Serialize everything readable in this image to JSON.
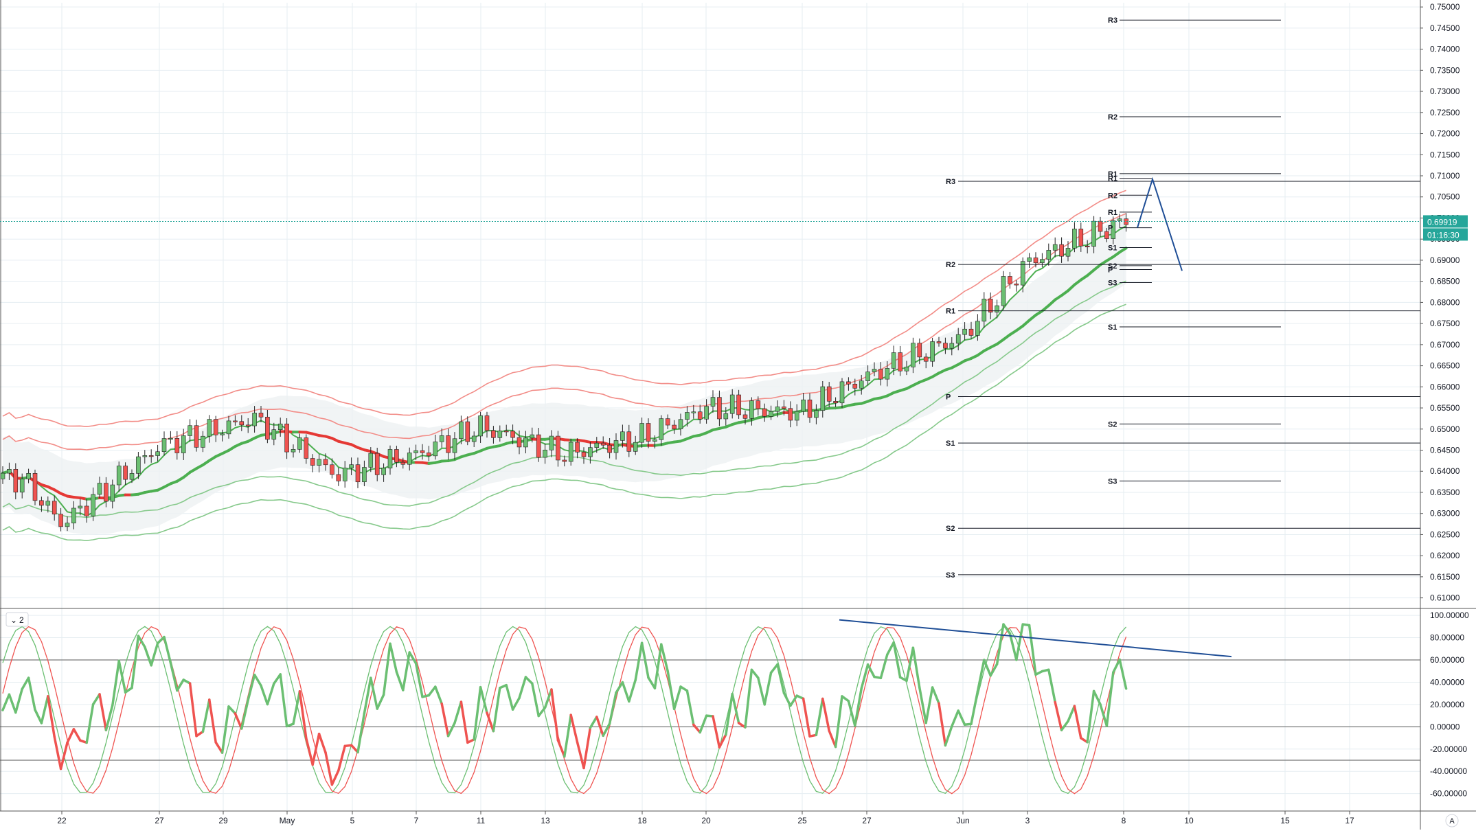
{
  "colors": {
    "bull": "#6BBF72",
    "bear": "#EF5350",
    "ma_green": "#4CAF50",
    "ma_red": "#E53935",
    "band_upper": "#F28C87",
    "band_lower": "#86C98B",
    "trend_line": "#1F4E96",
    "price_badge": "#26A69A",
    "grid": "#E6EEF2",
    "axis_text": "#131722",
    "pivot_line": "#131722"
  },
  "price_badge": "0.69919",
  "countdown_badge": "01:16:30",
  "oscillator_toggle_label": "2",
  "auto_scale_label": "A",
  "chart_data": [
    {
      "type": "candlestick",
      "title": "",
      "x_ticks": [
        "22",
        "27",
        "29",
        "May",
        "5",
        "7",
        "11",
        "13",
        "18",
        "20",
        "25",
        "27",
        "Jun",
        "3",
        "8",
        "10",
        "15",
        "17"
      ],
      "y_ticks": [
        "0.75000",
        "0.74500",
        "0.74000",
        "0.73500",
        "0.73000",
        "0.72500",
        "0.72000",
        "0.71500",
        "0.71000",
        "0.70500",
        "0.70000",
        "0.69500",
        "0.69000",
        "0.68500",
        "0.68000",
        "0.67500",
        "0.67000",
        "0.66500",
        "0.66000",
        "0.65500",
        "0.65000",
        "0.64500",
        "0.64000",
        "0.63500",
        "0.63000",
        "0.62500",
        "0.62000",
        "0.61500",
        "0.61000"
      ],
      "ylim": [
        0.6075,
        0.751
      ],
      "last_price": 0.69919,
      "ohlc_sample": [
        {
          "x": "Apr 20",
          "open": 0.637,
          "high": 0.6395,
          "low": 0.6345,
          "close": 0.6382
        },
        {
          "x": "Apr 22",
          "open": 0.633,
          "high": 0.635,
          "low": 0.6255,
          "close": 0.6275
        },
        {
          "x": "Apr 27",
          "open": 0.643,
          "high": 0.6468,
          "low": 0.642,
          "close": 0.646
        },
        {
          "x": "Apr 30",
          "open": 0.6545,
          "high": 0.657,
          "low": 0.651,
          "close": 0.6525
        },
        {
          "x": "May 4",
          "open": 0.642,
          "high": 0.644,
          "low": 0.6375,
          "close": 0.639
        },
        {
          "x": "May 7",
          "open": 0.64,
          "high": 0.6445,
          "low": 0.6385,
          "close": 0.644
        },
        {
          "x": "May 11",
          "open": 0.653,
          "high": 0.656,
          "low": 0.649,
          "close": 0.6505
        },
        {
          "x": "May 14",
          "open": 0.647,
          "high": 0.649,
          "low": 0.642,
          "close": 0.644
        },
        {
          "x": "May 18",
          "open": 0.6435,
          "high": 0.649,
          "low": 0.643,
          "close": 0.648
        },
        {
          "x": "May 20",
          "open": 0.6545,
          "high": 0.657,
          "low": 0.6525,
          "close": 0.655
        },
        {
          "x": "May 25",
          "open": 0.6535,
          "high": 0.655,
          "low": 0.6515,
          "close": 0.654
        },
        {
          "x": "May 27",
          "open": 0.666,
          "high": 0.668,
          "low": 0.661,
          "close": 0.6625
        },
        {
          "x": "Jun 1",
          "open": 0.669,
          "high": 0.673,
          "low": 0.668,
          "close": 0.672
        },
        {
          "x": "Jun 3",
          "open": 0.692,
          "high": 0.696,
          "low": 0.687,
          "close": 0.6895
        },
        {
          "x": "Jun 8",
          "open": 0.6975,
          "high": 0.7005,
          "low": 0.696,
          "close": 0.6992
        }
      ],
      "pivot_levels": [
        {
          "label": "R3",
          "value": 0.7087
        },
        {
          "label": "R2",
          "value": 0.689
        },
        {
          "label": "R1",
          "value": 0.678
        },
        {
          "label": "P",
          "value": 0.6577
        },
        {
          "label": "S1",
          "value": 0.6467
        },
        {
          "label": "S2",
          "value": 0.6265
        },
        {
          "label": "S3",
          "value": 0.6155
        },
        {
          "label": "R3",
          "value": 0.7469
        },
        {
          "label": "R2",
          "value": 0.724
        },
        {
          "label": "R1",
          "value": 0.7105
        },
        {
          "label": "S1",
          "value": 0.6742
        },
        {
          "label": "S2",
          "value": 0.6512
        },
        {
          "label": "S3",
          "value": 0.6377
        },
        {
          "label": "R1",
          "value": 0.7094
        },
        {
          "label": "R2",
          "value": 0.7054
        },
        {
          "label": "R1",
          "value": 0.7014
        },
        {
          "label": "P",
          "value": 0.6977
        },
        {
          "label": "S1",
          "value": 0.693
        },
        {
          "label": "S2",
          "value": 0.6887
        },
        {
          "label": "P",
          "value": 0.6878
        },
        {
          "label": "S3",
          "value": 0.6847
        }
      ],
      "projection_path": [
        {
          "x": "Jun 8",
          "y": 0.6977
        },
        {
          "x": "Jun 9",
          "y": 0.7092
        },
        {
          "x": "Jun 10",
          "y": 0.6875
        }
      ]
    },
    {
      "type": "line",
      "title": "",
      "y_ticks": [
        "100.00000",
        "80.00000",
        "60.00000",
        "40.00000",
        "20.00000",
        "0.00000",
        "-20.00000",
        "-40.00000",
        "-60.00000"
      ],
      "ylim": [
        -75,
        105
      ],
      "horizontal_levels": [
        60,
        0,
        -30
      ],
      "divergence_line": {
        "from": {
          "x": "May 26",
          "y": 96
        },
        "to": {
          "x": "Jun 12",
          "y": 63
        }
      },
      "last_value": 40
    }
  ]
}
